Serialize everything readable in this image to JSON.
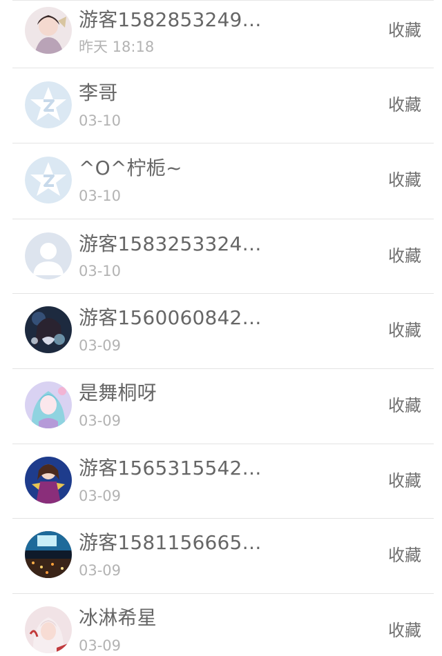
{
  "contacts": [
    {
      "name": "游客1582853249…",
      "time": "昨天 18:18",
      "action": "收藏",
      "avatar": "anime-girl-avatar"
    },
    {
      "name": "李哥",
      "time": "03-10",
      "action": "收藏",
      "avatar": "qzone-star-default-avatar"
    },
    {
      "name": "^O^柠栀~",
      "time": "03-10",
      "action": "收藏",
      "avatar": "qzone-star-default-avatar"
    },
    {
      "name": "游客1583253324…",
      "time": "03-10",
      "action": "收藏",
      "avatar": "default-person-avatar"
    },
    {
      "name": "游客1560060842…",
      "time": "03-09",
      "action": "收藏",
      "avatar": "anime-dark-avatar"
    },
    {
      "name": "是舞桐呀",
      "time": "03-09",
      "action": "收藏",
      "avatar": "anime-pastel-avatar"
    },
    {
      "name": "游客1565315542…",
      "time": "03-09",
      "action": "收藏",
      "avatar": "anime-purple-avatar"
    },
    {
      "name": "游客1581156665…",
      "time": "03-09",
      "action": "收藏",
      "avatar": "city-night-avatar"
    },
    {
      "name": "冰淋希星",
      "time": "03-09",
      "action": "收藏",
      "avatar": "anime-light-avatar"
    }
  ]
}
